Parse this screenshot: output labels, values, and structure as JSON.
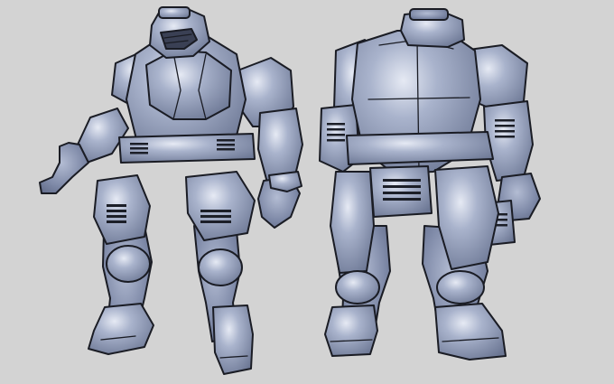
{
  "image": {
    "subject": "armored-suit-turnaround",
    "views": [
      {
        "id": "front",
        "label": ""
      },
      {
        "id": "back",
        "label": ""
      }
    ],
    "colors": {
      "background": "#d3d3d3",
      "armor_base": "#8e9ab6",
      "armor_shadow": "#6f7a97",
      "armor_highlight": "#dfe4f0",
      "outline": "#1a1c24"
    }
  }
}
